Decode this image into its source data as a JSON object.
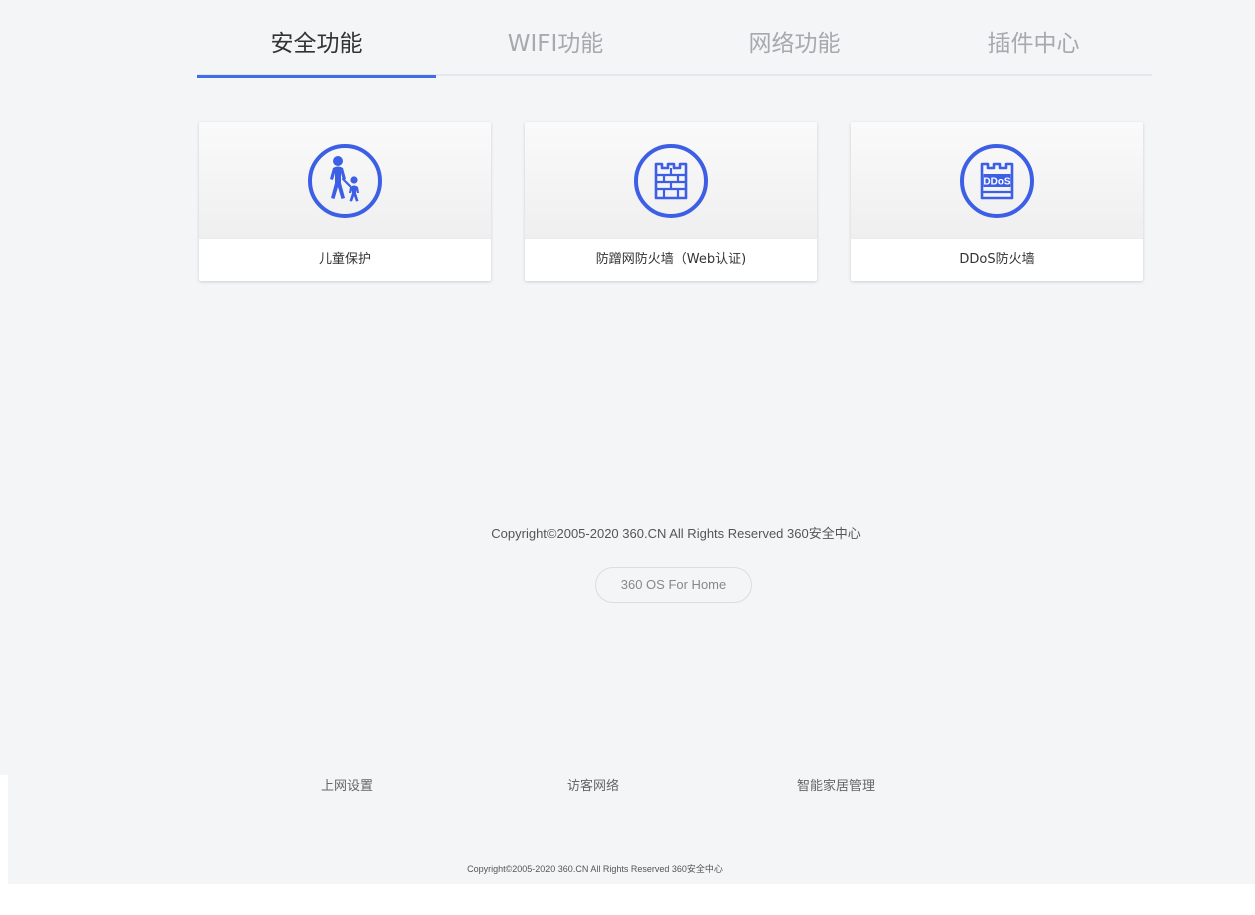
{
  "tabs": [
    {
      "label": "安全功能",
      "active": true
    },
    {
      "label": "WIFI功能",
      "active": false
    },
    {
      "label": "网络功能",
      "active": false
    },
    {
      "label": "插件中心",
      "active": false
    }
  ],
  "cards": [
    {
      "label": "儿童保护",
      "icon": "child-protection-icon"
    },
    {
      "label": "防蹭网防火墙（Web认证)",
      "icon": "firewall-icon"
    },
    {
      "label": "DDoS防火墙",
      "icon": "ddos-firewall-icon",
      "icon_text": "DDoS"
    }
  ],
  "footer": {
    "copyright": "Copyright©2005-2020 360.CN All Rights Reserved 360安全中心",
    "os_badge": "360 OS For Home"
  },
  "bottom_nav": {
    "links": [
      "上网设置",
      "访客网络",
      "智能家居管理"
    ],
    "copyright": "Copyright©2005-2020 360.CN All Rights Reserved 360安全中心"
  },
  "colors": {
    "accent": "#3d6ee8",
    "icon_blue": "#3d5fe6",
    "page_bg": "#f4f5f7"
  }
}
